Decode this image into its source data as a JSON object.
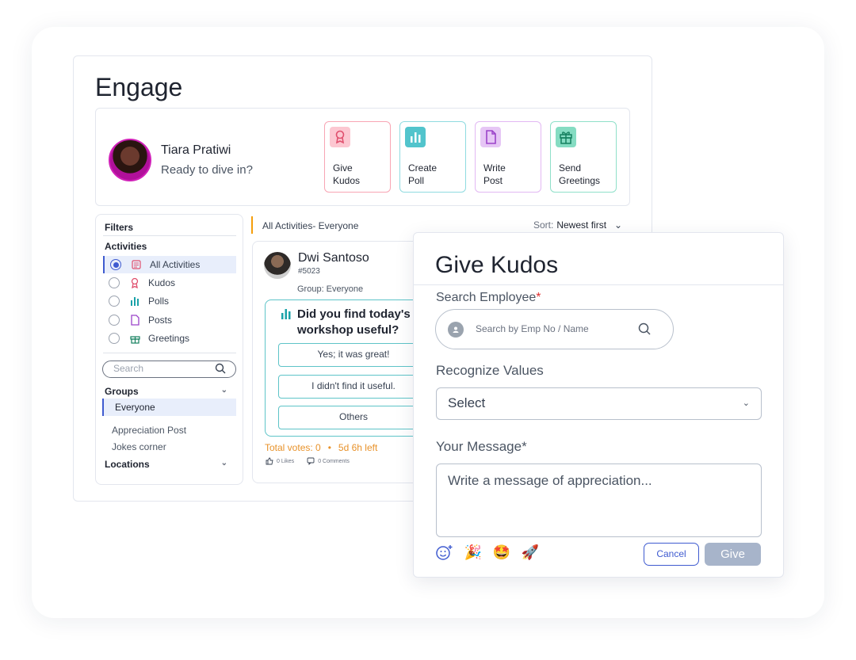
{
  "app": {
    "title": "Engage"
  },
  "user": {
    "name": "Tiara Pratiwi",
    "greeting": "Ready to dive in?"
  },
  "actions": [
    {
      "label": "Give\nKudos",
      "icon": "ribbon-icon",
      "color": "#f37f93"
    },
    {
      "label": "Create\nPoll",
      "icon": "bar-chart-icon",
      "color": "#3fbcc4"
    },
    {
      "label": "Write\nPost",
      "icon": "document-icon",
      "color": "#b068d8"
    },
    {
      "label": "Send\nGreetings",
      "icon": "gift-icon",
      "color": "#2fb996"
    }
  ],
  "filters": {
    "title": "Filters",
    "activities_label": "Activities",
    "activities": [
      {
        "label": "All Activities",
        "selected": true
      },
      {
        "label": "Kudos",
        "selected": false
      },
      {
        "label": "Polls",
        "selected": false
      },
      {
        "label": "Posts",
        "selected": false
      },
      {
        "label": "Greetings",
        "selected": false
      }
    ],
    "search_placeholder": "Search",
    "groups_label": "Groups",
    "selected_group": "Everyone",
    "groups": [
      "Appreciation Post",
      "Jokes corner"
    ],
    "locations_label": "Locations"
  },
  "feed": {
    "title": "All Activities- Everyone",
    "sort_label": "Sort:",
    "sort_value": "Newest first"
  },
  "post": {
    "author": "Dwi Santoso",
    "emp_id": "#5023",
    "group": "Group: Everyone",
    "question": "Did you find today's workshop useful?",
    "options": [
      "Yes; it was great!",
      "I didn't find it useful.",
      "Others"
    ],
    "total_votes": "Total votes: 0",
    "time_left": "5d 6h left",
    "likes": "0 Likes",
    "comments": "0 Comments"
  },
  "modal": {
    "title": "Give Kudos",
    "search_label": "Search Employee",
    "search_placeholder": "Search by Emp No / Name",
    "values_label": "Recognize Values",
    "values_select": "Select",
    "message_label": "Your Message",
    "message_placeholder": "Write a message of appreciation...",
    "cancel_label": "Cancel",
    "give_label": "Give",
    "accent": "#3f5bd0"
  }
}
